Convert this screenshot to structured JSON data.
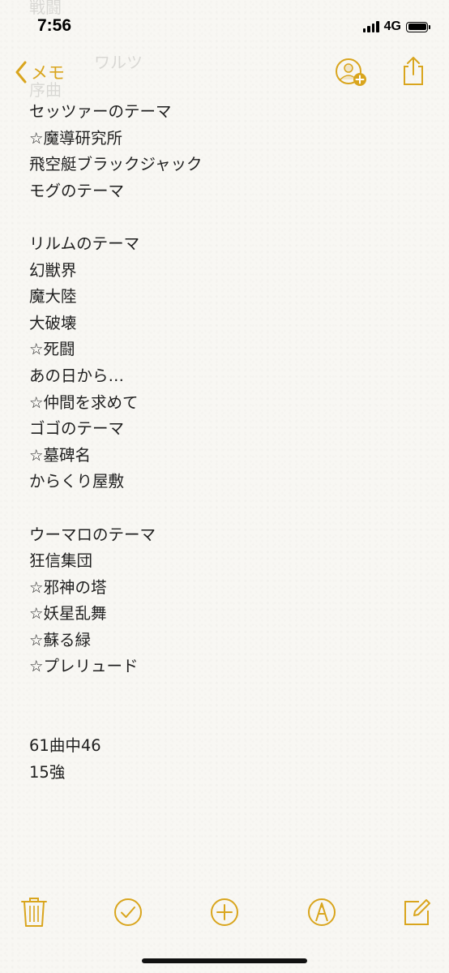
{
  "status_bar": {
    "time": "7:56",
    "network": "4G"
  },
  "nav": {
    "back_label": "メモ",
    "accent": "#d9a51d"
  },
  "ghost_lines": [
    "戦闘",
    "",
    "ワルツ",
    "序曲"
  ],
  "note": {
    "lines": [
      "セッツァーのテーマ",
      "☆魔導研究所",
      "飛空艇ブラックジャック",
      "モグのテーマ",
      "",
      "リルムのテーマ",
      "幻獣界",
      "魔大陸",
      "大破壊",
      "☆死闘",
      "あの日から…",
      "☆仲間を求めて",
      "ゴゴのテーマ",
      "☆墓碑名",
      "からくり屋敷",
      "",
      "ウーマロのテーマ",
      "狂信集団",
      "☆邪神の塔",
      "☆妖星乱舞",
      "☆蘇る緑",
      "☆プレリュード",
      "",
      "",
      "61曲中46",
      "15強"
    ]
  },
  "toolbar": {
    "icons": [
      "trash-icon",
      "checklist-icon",
      "add-icon",
      "markup-icon",
      "compose-icon"
    ]
  }
}
